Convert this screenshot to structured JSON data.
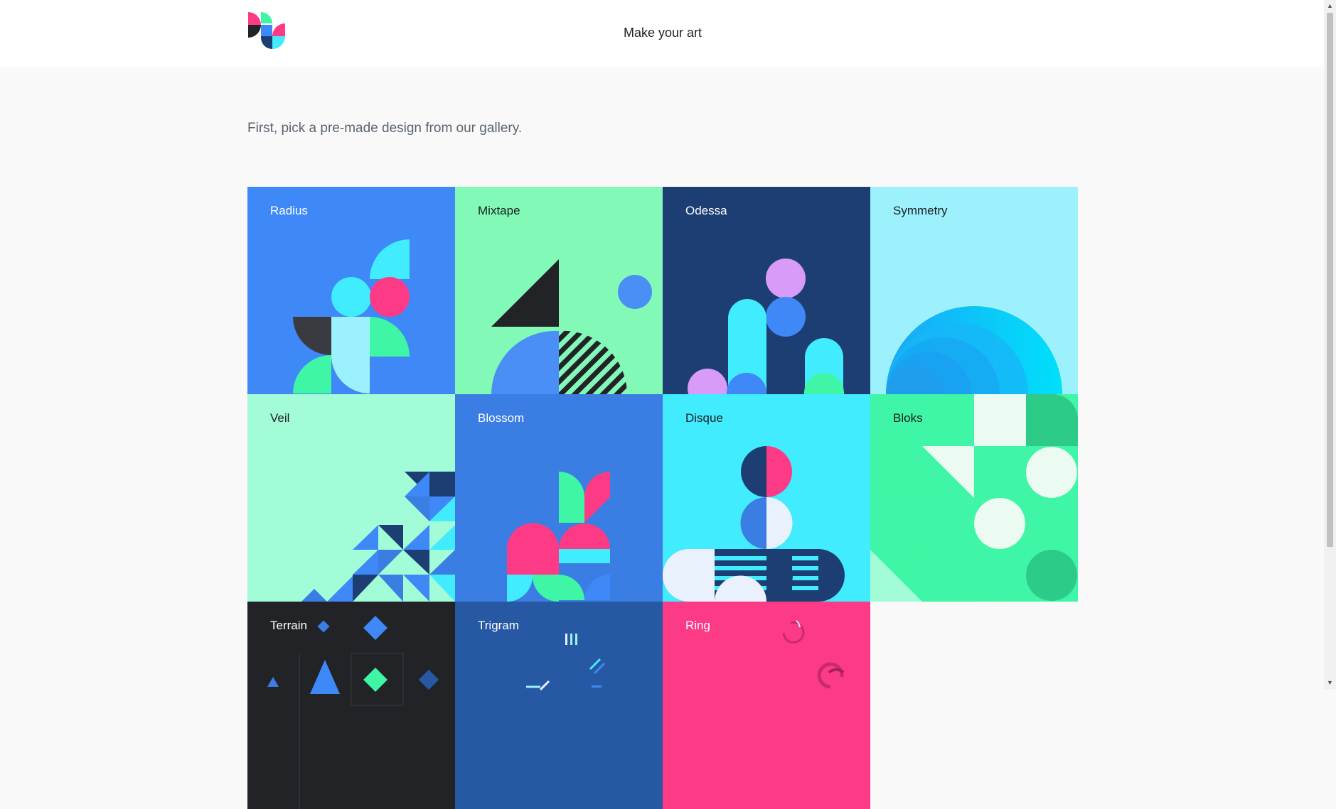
{
  "header": {
    "title": "Make your art",
    "logo_icon": "geometric-leaf-logo-icon"
  },
  "intro": {
    "text": "First, pick a pre-made design from our gallery."
  },
  "gallery": {
    "tiles": [
      {
        "label": "Radius",
        "bg": "#3f88f8",
        "label_color": "#ffffff"
      },
      {
        "label": "Mixtape",
        "bg": "#83f9b7",
        "label_color": "#1c1e22"
      },
      {
        "label": "Odessa",
        "bg": "#1d3e73",
        "label_color": "#ffffff"
      },
      {
        "label": "Symmetry",
        "bg": "#9cf1fc",
        "label_color": "#1c1e22"
      },
      {
        "label": "Veil",
        "bg": "#a2fcd8",
        "label_color": "#1c1e22"
      },
      {
        "label": "Blossom",
        "bg": "#3a7de3",
        "label_color": "#ffffff"
      },
      {
        "label": "Disque",
        "bg": "#40ecfe",
        "label_color": "#1c1e22"
      },
      {
        "label": "Bloks",
        "bg": "#3ff5a6",
        "label_color": "#1c1e22"
      },
      {
        "label": "Terrain",
        "bg": "#222327",
        "label_color": "#ffffff"
      },
      {
        "label": "Trigram",
        "bg": "#2658a3",
        "label_color": "#ffffff"
      },
      {
        "label": "Ring",
        "bg": "#fd3a86",
        "label_color": "#ffffff"
      }
    ]
  },
  "colors": {
    "page_bg": "#f9f9f9",
    "header_bg": "#ffffff",
    "intro_text": "#5b6470"
  }
}
